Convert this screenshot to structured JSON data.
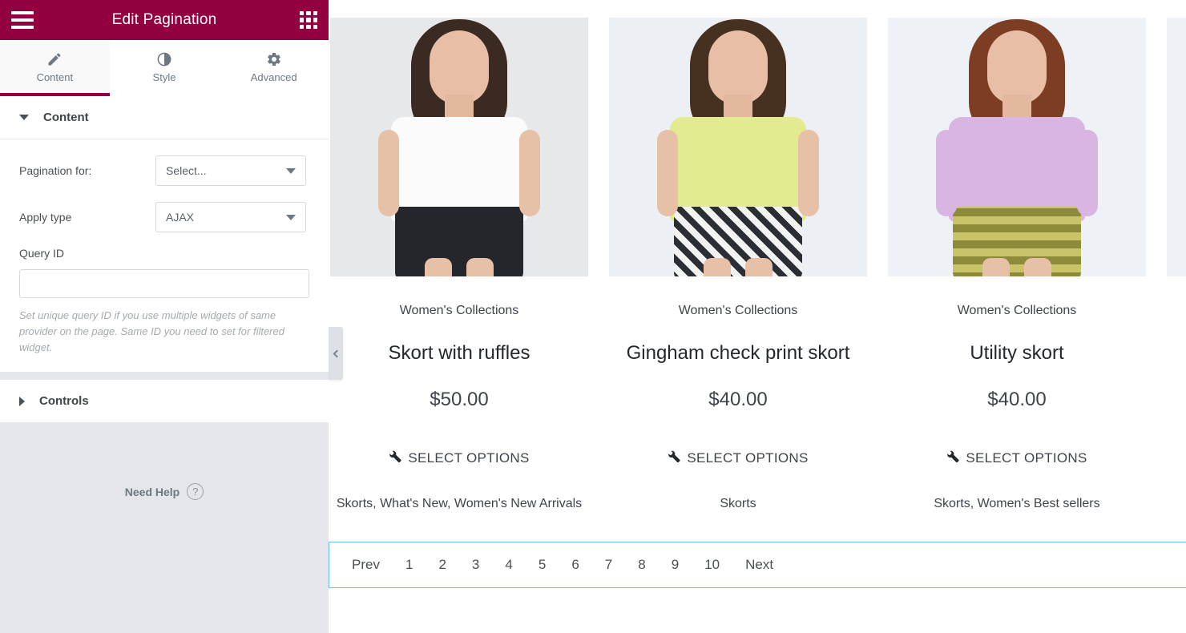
{
  "panel": {
    "header": {
      "title": "Edit Pagination",
      "menu_icon": "hamburger-menu-icon",
      "grid_icon": "widgets-grid-icon"
    },
    "tabs": [
      {
        "label": "Content",
        "icon": "pencil-icon",
        "active": true
      },
      {
        "label": "Style",
        "icon": "contrast-circle-icon",
        "active": false
      },
      {
        "label": "Advanced",
        "icon": "gear-icon",
        "active": false
      }
    ],
    "sections": [
      {
        "title": "Content",
        "expanded": true
      },
      {
        "title": "Controls",
        "expanded": false
      }
    ],
    "content_section": {
      "pagination_for": {
        "label": "Pagination for:",
        "value": "Select...",
        "icon": "chevron-down-icon"
      },
      "apply_type": {
        "label": "Apply type",
        "value": "AJAX",
        "icon": "chevron-down-icon"
      },
      "query_id": {
        "label": "Query ID",
        "value": "",
        "placeholder": "",
        "help": "Set unique query ID if you use multiple widgets of same provider on the page. Same ID you need to set for filtered widget."
      }
    },
    "need_help": {
      "label": "Need Help",
      "icon": "question-mark-circle-icon"
    }
  },
  "preview": {
    "collapse_handle_icon": "chevron-left-icon",
    "products": [
      {
        "category": "Women's Collections",
        "name": "Skort with ruffles",
        "price": "$50.00",
        "action": "SELECT OPTIONS",
        "action_icon": "wrench-icon",
        "tags": "Skorts, What's New, Women's New Arrivals"
      },
      {
        "category": "Women's Collections",
        "name": "Gingham check print skort",
        "price": "$40.00",
        "action": "SELECT OPTIONS",
        "action_icon": "wrench-icon",
        "tags": "Skorts"
      },
      {
        "category": "Women's Collections",
        "name": "Utility skort",
        "price": "$40.00",
        "action": "SELECT OPTIONS",
        "action_icon": "wrench-icon",
        "tags": "Skorts, Women's Best sellers"
      }
    ],
    "pagination": {
      "prev": "Prev",
      "pages": [
        "1",
        "2",
        "3",
        "4",
        "5",
        "6",
        "7",
        "8",
        "9",
        "10"
      ],
      "next": "Next"
    }
  },
  "colors": {
    "brand": "#93003f",
    "panel_bg": "#e4e6eb",
    "selection_outline": "#6ec1e4",
    "text": "#3f444b"
  }
}
